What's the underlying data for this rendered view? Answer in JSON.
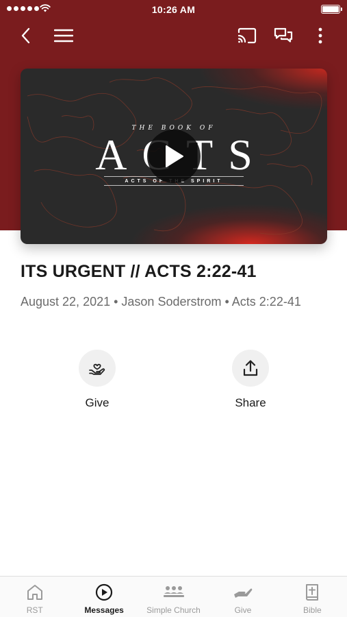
{
  "status_bar": {
    "time": "10:26 AM"
  },
  "colors": {
    "header_bg": "#7a1c1e",
    "accent": "#d6302a",
    "text_primary": "#1a1a1a",
    "text_secondary": "#6b6b6b"
  },
  "nav": {
    "back_icon": "chevron-left-icon",
    "menu_icon": "hamburger-menu-icon",
    "cast_icon": "cast-icon",
    "chat_icon": "chat-bubbles-icon",
    "more_icon": "more-vertical-icon"
  },
  "hero": {
    "over_title": "THE BOOK OF",
    "main_title": "ACTS",
    "subtitle": "ACTS OF THE SPIRIT",
    "play_icon": "play-icon"
  },
  "message": {
    "title": "ITS URGENT // ACTS 2:22-41",
    "meta": "August 22, 2021 • Jason Soderstrom • Acts 2:22-41"
  },
  "actions": [
    {
      "label": "Give",
      "icon": "heart-hand-icon"
    },
    {
      "label": "Share",
      "icon": "share-upload-icon"
    }
  ],
  "tabs": [
    {
      "label": "RST",
      "icon": "home-icon",
      "active": false
    },
    {
      "label": "Messages",
      "icon": "play-circle-icon",
      "active": true
    },
    {
      "label": "Simple Church",
      "icon": "people-group-icon",
      "active": false
    },
    {
      "label": "Give",
      "icon": "giving-hand-icon",
      "active": false
    },
    {
      "label": "Bible",
      "icon": "bible-icon",
      "active": false
    }
  ]
}
